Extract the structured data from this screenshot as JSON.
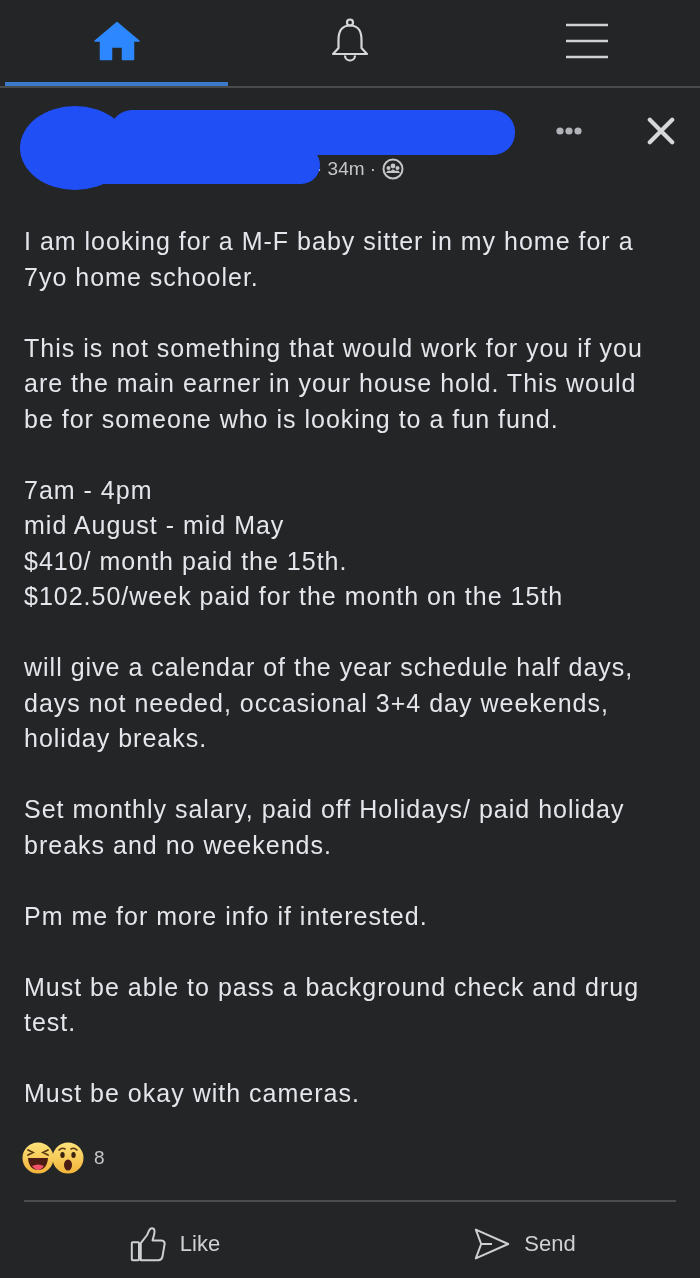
{
  "nav": {
    "tabs": [
      {
        "kind": "home",
        "selected": true
      },
      {
        "kind": "notifications",
        "selected": false
      },
      {
        "kind": "menu",
        "selected": false
      }
    ]
  },
  "post": {
    "meta": "· 34m ·",
    "paragraphs": [
      "I am looking for a M-F baby sitter in my home for a 7yo home schooler.",
      "This is not something that would work for you if you are the main earner in your house hold. This would be for someone who is looking to a fun fund.",
      "7am - 4pm\nmid August - mid May\n$410/ month paid the 15th.\n$102.50/week paid for the month on the 15th",
      "will give a calendar of the year schedule half days, days not needed, occasional 3+4 day weekends, holiday breaks.",
      "Set monthly salary, paid off Holidays/ paid holiday breaks and no weekends.",
      "Pm me for more info if interested.",
      "Must be able to pass a background check and drug test.",
      "Must be okay with cameras."
    ],
    "reaction_count": "8"
  },
  "actions": [
    {
      "kind": "like",
      "label": "Like"
    },
    {
      "kind": "send",
      "label": "Send"
    }
  ]
}
